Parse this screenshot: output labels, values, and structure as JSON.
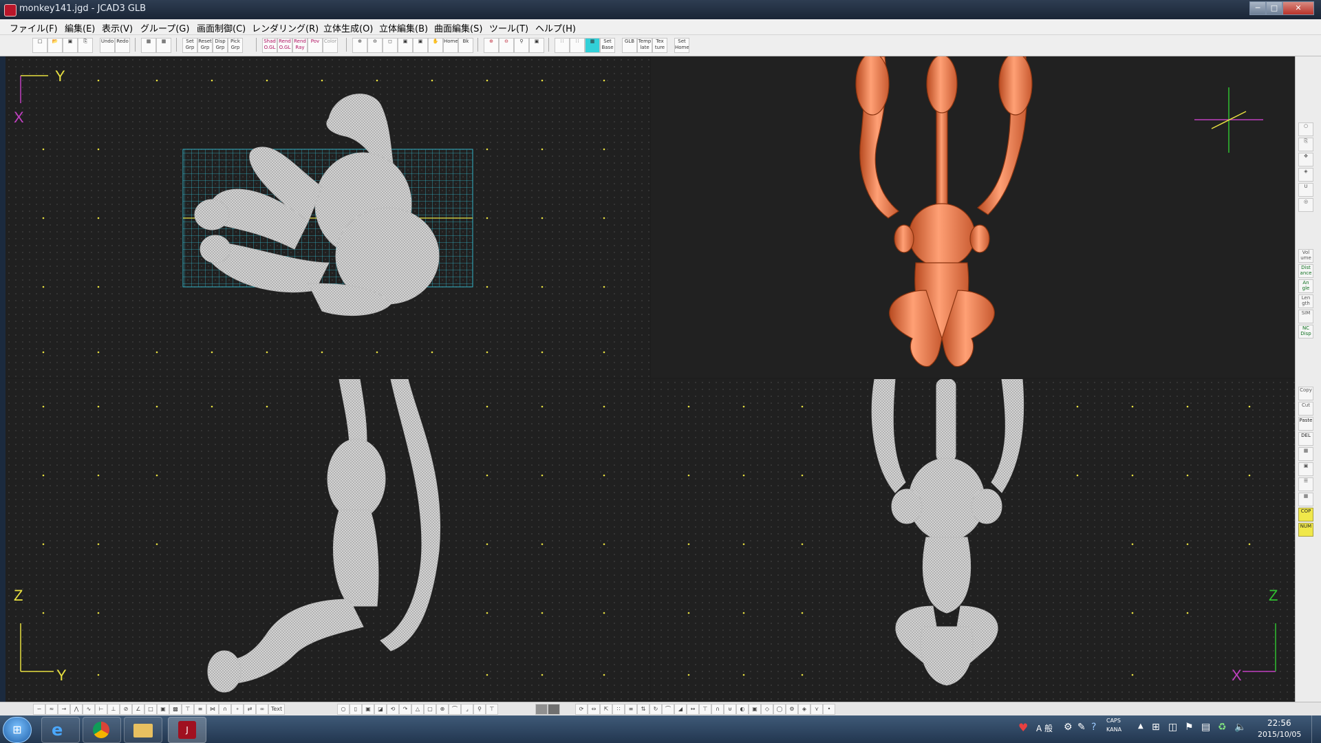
{
  "window": {
    "title": "monkey141.jgd - JCAD3 GLB",
    "min": "─",
    "max": "□",
    "close": "✕"
  },
  "menu": [
    "ファイル(F)",
    "編集(E)",
    "表示(V)",
    "グループ(G)",
    "画面制御(C)",
    "レンダリング(R)",
    "立体生成(O)",
    "立体編集(B)",
    "曲面編集(S)",
    "ツール(T)",
    "ヘルプ(H)"
  ],
  "toolbar": {
    "undo": "Undo",
    "redo": "Redo",
    "set_grp": "Set Grp",
    "reset_grp": "Reset Grp",
    "disp_grp": "Disp Grp",
    "pick_grp": "Pick Grp",
    "shad_ogl": "Shad O.GL",
    "rend_ogl": "Rend O.GL",
    "rend_ray": "Rend Ray",
    "pov": "Pov",
    "color": "Color",
    "home": "Home",
    "bk": "Bk",
    "set_base": "Set Base",
    "glb": "GLB",
    "template": "Temp late",
    "texture": "Tex ture",
    "set_home": "Set Home"
  },
  "viewports": {
    "top": {
      "axis_h": "Y",
      "axis_v": "X"
    },
    "side": {
      "axis_v": "Z",
      "axis_h": "Y"
    },
    "front": {
      "axis_v": "Z",
      "axis_h": "X"
    }
  },
  "right_palette": {
    "volume": "Vol ume",
    "distance": "Dist ance",
    "angle": "An gle",
    "length": "Len gth",
    "sim": "SIM",
    "nc_disp": "NC Disp",
    "copy": "Copy",
    "cut": "Cut",
    "paste": "Paste",
    "del": "DEL",
    "cop": "COP",
    "num": "NUM"
  },
  "bottom_toolbar": {
    "text": "Text"
  },
  "taskbar": {
    "time": "22:56",
    "date": "2015/10/05",
    "ime": "A 般",
    "caps": "CAPS",
    "kana": "KANA"
  },
  "colors": {
    "grid_cyan": "#33b4c8",
    "axis_yellow": "#e8e040",
    "axis_magenta": "#c040c0",
    "axis_green": "#30c030",
    "monkey_orange": "#f08050",
    "wire_gray": "#c9c9c9"
  }
}
